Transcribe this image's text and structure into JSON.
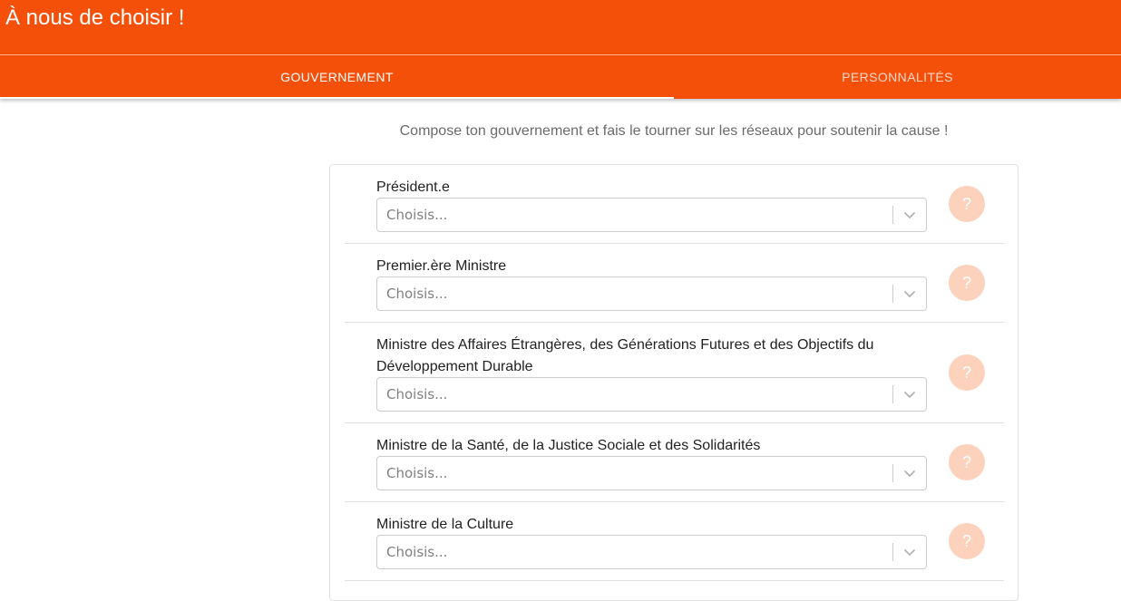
{
  "app": {
    "title": "À nous de choisir !"
  },
  "tabs": [
    {
      "label": "GOUVERNEMENT",
      "active": true
    },
    {
      "label": "PERSONNALITÉS",
      "active": false
    }
  ],
  "intro": "Compose ton gouvernement et fais le tourner sur les réseaux pour soutenir la cause !",
  "roles": [
    {
      "label": "Président.e",
      "placeholder": "Choisis...",
      "help": "?"
    },
    {
      "label": "Premier.ère Ministre",
      "placeholder": "Choisis...",
      "help": "?"
    },
    {
      "label": "Ministre des Affaires Étrangères, des Générations Futures et des Objectifs du Développement Durable",
      "placeholder": "Choisis...",
      "help": "?"
    },
    {
      "label": "Ministre de la Santé, de la Justice Sociale et des Solidarités",
      "placeholder": "Choisis...",
      "help": "?"
    },
    {
      "label": "Ministre de la Culture",
      "placeholder": "Choisis...",
      "help": "?"
    }
  ],
  "colors": {
    "brand": "#f5500a",
    "help_button": "#fcd2bd"
  },
  "icons": {
    "select_indicator": "chevron-down-icon"
  }
}
